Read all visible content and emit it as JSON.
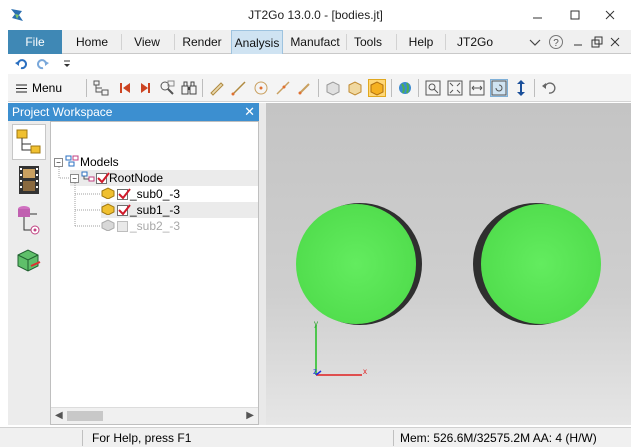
{
  "window": {
    "title": "JT2Go 13.0.0 - [bodies.jt]"
  },
  "ribbon": {
    "tabs": [
      {
        "label": "File"
      },
      {
        "label": "Home"
      },
      {
        "label": "View"
      },
      {
        "label": "Render"
      },
      {
        "label": "Analysis"
      },
      {
        "label": "Manufact"
      },
      {
        "label": "Tools"
      },
      {
        "label": "Help"
      },
      {
        "label": "JT2Go"
      }
    ],
    "active_tab": "Analysis",
    "right_icons": [
      "heart-icon",
      "help-icon",
      "minimize-ribbon-icon",
      "restore-ribbon-icon",
      "close-document-icon"
    ]
  },
  "quick_access": {
    "items": [
      "undo-icon",
      "redo-icon",
      "customize-icon"
    ]
  },
  "toolbar": {
    "menu_label": "Menu",
    "icons": [
      "assembly-tree-icon",
      "first-step-icon",
      "next-step-icon",
      "zoom-area-icon",
      "binoculars-icon",
      "measure-icon",
      "line-icon",
      "circle-icon",
      "arc-icon",
      "pen-icon",
      "box-icon",
      "box-open-icon",
      "box-solid-icon",
      "globe-icon",
      "fit-icon",
      "zoom-window-icon",
      "fit-width-icon",
      "rotate-icon",
      "pan-vertical-icon",
      "undo-view-icon"
    ]
  },
  "workspace": {
    "title": "Project Workspace",
    "side_tabs": [
      "assembly-icon",
      "film-icon",
      "database-icon",
      "cube-export-icon"
    ],
    "tree": [
      {
        "label": "Models",
        "expanded": true
      },
      {
        "label": "RootNode",
        "checked": true
      },
      {
        "label": "_sub0_-3",
        "checked": true
      },
      {
        "label": "_sub1_-3",
        "checked": true
      },
      {
        "label": "_sub2_-3",
        "checked": false
      }
    ]
  },
  "viewport": {
    "background": "#cacaca",
    "sphere_color": "#5ee85a",
    "shadow_color": "#3c3c3c",
    "triad": {
      "y_label": "y",
      "x_label": "x",
      "z_label": "z"
    }
  },
  "statusbar": {
    "help": "For Help, press F1",
    "memory": "Mem: 526.6M/32575.2M  AA: 4 (H/W)"
  }
}
